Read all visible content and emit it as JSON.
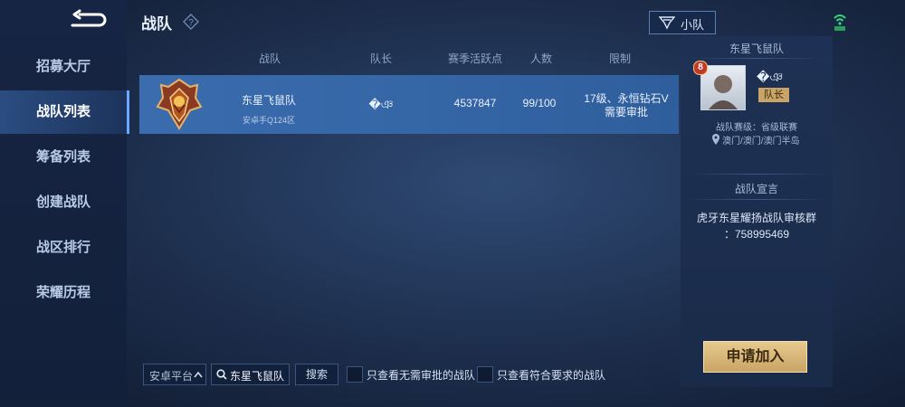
{
  "sidebar": {
    "items": [
      {
        "label": "招募大厅"
      },
      {
        "label": "战队列表"
      },
      {
        "label": "筹备列表"
      },
      {
        "label": "创建战队"
      },
      {
        "label": "战区排行"
      },
      {
        "label": "荣耀历程"
      }
    ],
    "active_index": 1
  },
  "header": {
    "title": "战队",
    "help_glyph": "?",
    "squad_button_label": "小队"
  },
  "table": {
    "columns": [
      "战队",
      "队长",
      "赛季活跃点",
      "人数",
      "限制"
    ],
    "rows": [
      {
        "team_name": "东星飞鼠队",
        "server": "安卓手Q124区",
        "captain": "�ঞ",
        "activity_points": "4537847",
        "members": "99/100",
        "restriction_line1": "17级、永恒钻石V",
        "restriction_line2": "需要审批"
      }
    ]
  },
  "detail": {
    "team_name": "东星飞鼠队",
    "captain_name": "�ঞ",
    "avatar_badge": "8",
    "role_badge": "队长",
    "division_text": "战队赛级：省级联赛",
    "location_text": "澳门/澳门/澳门半岛",
    "manifesto_title": "战队宣言",
    "manifesto_line1": "虎牙东星耀扬战队审核群",
    "manifesto_line2": "：758995469"
  },
  "bottom": {
    "platform_select": "安卓平台",
    "search_value": "东星飞鼠队",
    "search_button": "搜索",
    "filter1_label": "只查看无需审批的战队",
    "filter2_label": "只查看符合要求的战队",
    "apply_button": "申请加入"
  },
  "colors": {
    "accent": "#3a6cae",
    "apply_gold": "#d8b477",
    "signal_green": "#37d67a"
  }
}
